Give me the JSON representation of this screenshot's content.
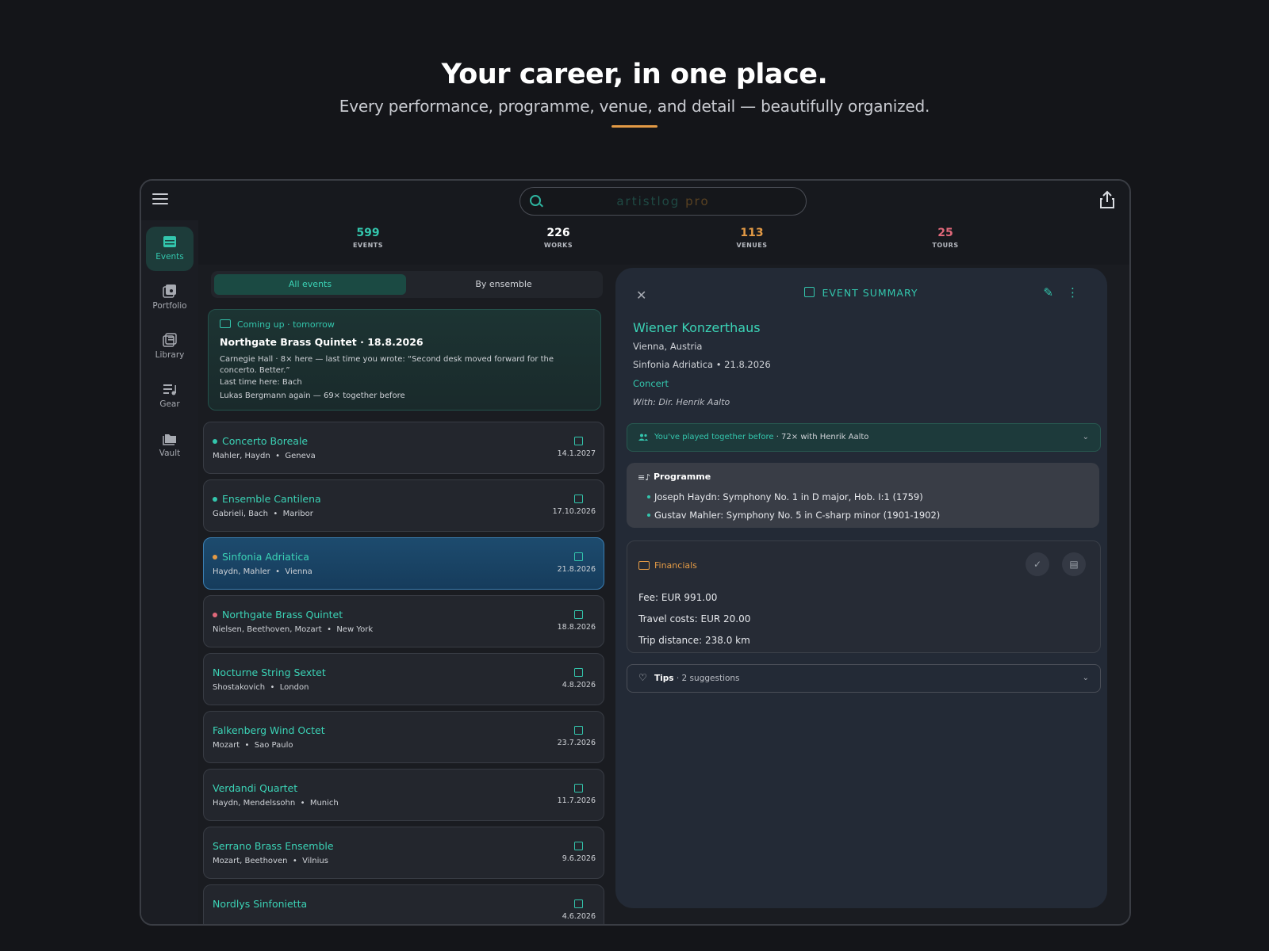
{
  "hero": {
    "title": "Your career, in one place.",
    "subtitle": "Every performance, programme, venue, and detail — beautifully organized."
  },
  "topbar": {
    "brand_a": "artistlog",
    "brand_b": "pro"
  },
  "sidebar": {
    "items": [
      {
        "label": "Events",
        "icon": "calendar-icon",
        "active": true
      },
      {
        "label": "Portfolio",
        "icon": "portfolio-icon",
        "active": false
      },
      {
        "label": "Library",
        "icon": "library-icon",
        "active": false
      },
      {
        "label": "Gear",
        "icon": "gear-icon",
        "active": false
      },
      {
        "label": "Vault",
        "icon": "folder-icon",
        "active": false
      }
    ]
  },
  "stats": [
    {
      "value": "599",
      "label": "EVENTS",
      "color": "#33c6ad"
    },
    {
      "value": "226",
      "label": "WORKS",
      "color": "#ffffff"
    },
    {
      "value": "113",
      "label": "VENUES",
      "color": "#e39a45"
    },
    {
      "value": "25",
      "label": "TOURS",
      "color": "#e0687a"
    }
  ],
  "segments": {
    "all": "All events",
    "by_ensemble": "By ensemble"
  },
  "coming_up": {
    "header": "Coming up · tomorrow",
    "title": "Northgate Brass Quintet · 18.8.2026",
    "text": "Carnegie Hall · 8× here — last time you wrote: “Second desk moved forward for the concerto. Better.”",
    "line1": "Last time here: Bach",
    "line2": "Lukas Bergmann again — 69× together before"
  },
  "events": [
    {
      "name": "Concerto Boreale",
      "sub": "Mahler, Haydn  •  Geneva",
      "date": "14.1.2027",
      "dot": "#33c6ad"
    },
    {
      "name": "Ensemble Cantilena",
      "sub": "Gabrieli, Bach  •  Maribor",
      "date": "17.10.2026",
      "dot": "#33c6ad"
    },
    {
      "name": "Sinfonia Adriatica",
      "sub": "Haydn, Mahler  •  Vienna",
      "date": "21.8.2026",
      "dot": "#e39a45",
      "selected": true
    },
    {
      "name": "Northgate Brass Quintet",
      "sub": "Nielsen, Beethoven, Mozart  •  New York",
      "date": "18.8.2026",
      "dot": "#e0687a"
    },
    {
      "name": "Nocturne String Sextet",
      "sub": "Shostakovich  •  London",
      "date": "4.8.2026",
      "dot": ""
    },
    {
      "name": "Falkenberg Wind Octet",
      "sub": "Mozart  •  Sao Paulo",
      "date": "23.7.2026",
      "dot": ""
    },
    {
      "name": "Verdandi Quartet",
      "sub": "Haydn, Mendelssohn  •  Munich",
      "date": "11.7.2026",
      "dot": ""
    },
    {
      "name": "Serrano Brass Ensemble",
      "sub": "Mozart, Beethoven  •  Vilnius",
      "date": "9.6.2026",
      "dot": ""
    },
    {
      "name": "Nordlys Sinfonietta",
      "sub": "",
      "date": "4.6.2026",
      "dot": ""
    }
  ],
  "summary": {
    "header": "EVENT SUMMARY",
    "venue": "Wiener Konzerthaus",
    "location": "Vienna, Austria",
    "ensemble_date": "Sinfonia Adriatica • 21.8.2026",
    "type": "Concert",
    "with": "With: Dir. Henrik Aalto",
    "together_main": "You've played together before",
    "together_detail": " · 72× with Henrik Aalto",
    "programme_header": "Programme",
    "programme": [
      "Joseph Haydn: Symphony No. 1 in D major, Hob. I:1 (1759)",
      "Gustav Mahler: Symphony No. 5 in C-sharp minor (1901-1902)"
    ],
    "financials_header": "Financials",
    "fee": "Fee: EUR 991.00",
    "travel": "Travel costs: EUR 20.00",
    "distance": "Trip distance: 238.0 km",
    "tips_label": "Tips",
    "tips_detail": " · 2 suggestions"
  }
}
